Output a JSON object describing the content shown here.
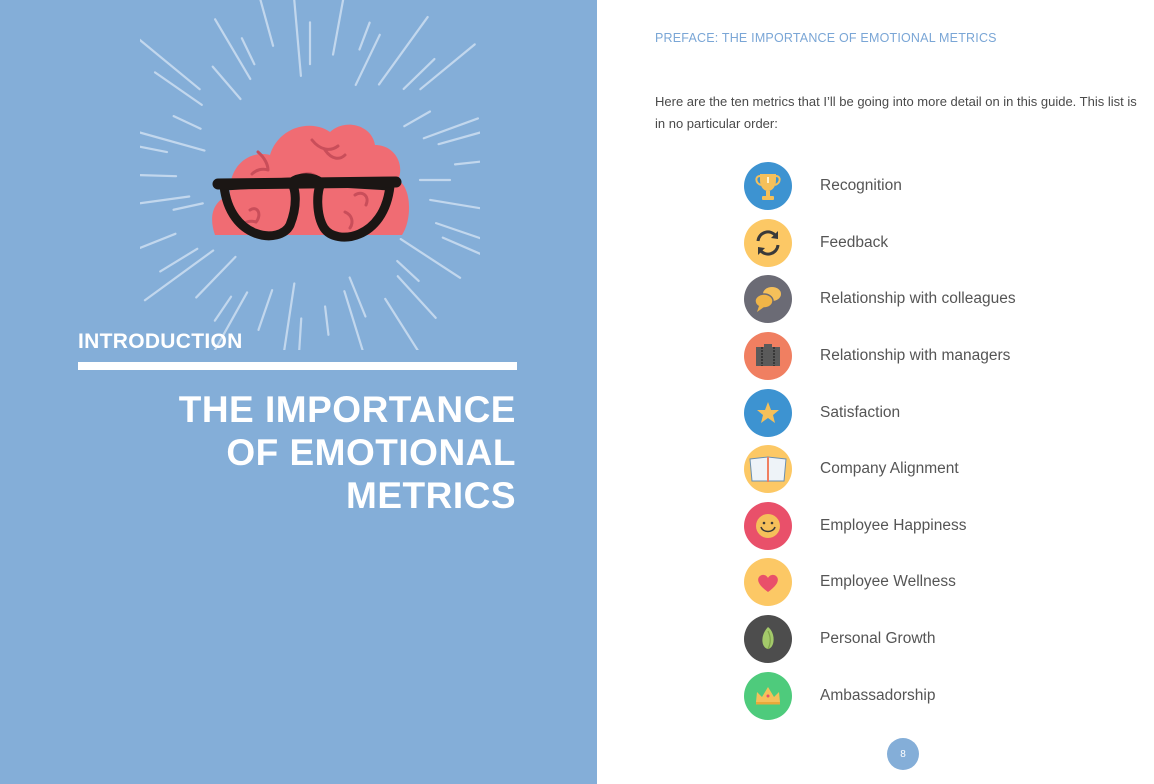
{
  "left_page": {
    "section_label": "INTRODUCTION",
    "title_lines": [
      "THE IMPORTANCE",
      "OF EMOTIONAL",
      "METRICS"
    ],
    "background_color": "#84aed8",
    "illustration": "brain-with-glasses"
  },
  "right_page": {
    "running_head": "PREFACE: THE IMPORTANCE OF EMOTIONAL METRICS",
    "intro_text": "Here are the ten metrics that I’ll be going into more detail on in this guide. This list is in no particular order:",
    "metrics": [
      {
        "label": "Recognition",
        "icon": "trophy-icon",
        "color": "#3d93d1"
      },
      {
        "label": "Feedback",
        "icon": "refresh-arrows-icon",
        "color": "#fcc865"
      },
      {
        "label": "Relationship with colleagues",
        "icon": "speech-bubbles-icon",
        "color": "#6b6b75"
      },
      {
        "label": "Relationship with managers",
        "icon": "briefcase-icon",
        "color": "#f07f61"
      },
      {
        "label": "Satisfaction",
        "icon": "star-icon",
        "color": "#3d93d1"
      },
      {
        "label": "Company Alignment",
        "icon": "open-book-icon",
        "color": "#fcc865"
      },
      {
        "label": "Employee Happiness",
        "icon": "smiley-face-icon",
        "color": "#e9506a"
      },
      {
        "label": "Employee Wellness",
        "icon": "heart-icon",
        "color": "#fcc865"
      },
      {
        "label": "Personal Growth",
        "icon": "leaf-icon",
        "color": "#4d4d4d"
      },
      {
        "label": "Ambassadorship",
        "icon": "crown-icon",
        "color": "#4ecb7c"
      }
    ],
    "page_number": "8"
  }
}
